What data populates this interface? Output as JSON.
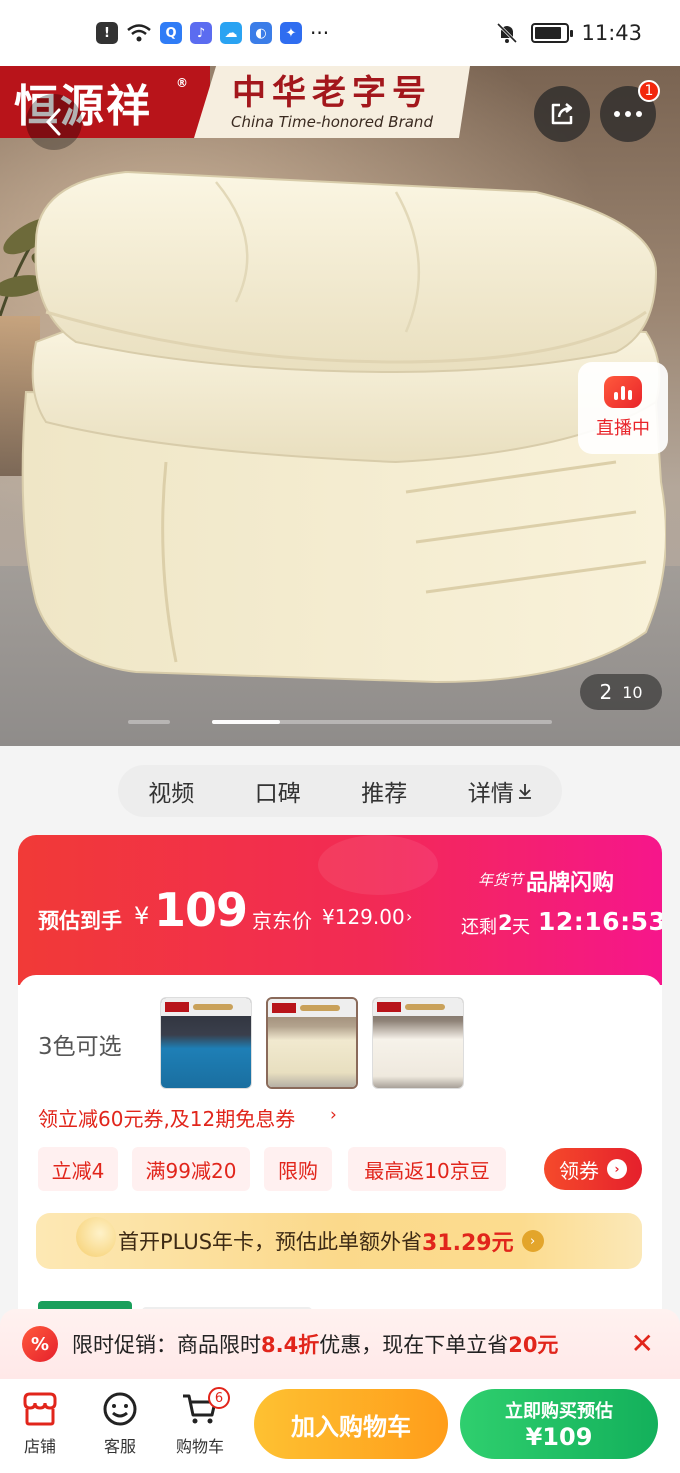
{
  "status_bar": {
    "time": "11:43",
    "more_glyph": "···"
  },
  "hero": {
    "brand_name": "恒源祥",
    "brand_registered": "®",
    "brand_tagline_cn": "中华老字号",
    "brand_tagline_en": "China Time-honored Brand",
    "share_icon": "share-icon",
    "more_badge": "1",
    "live_label": "直播中",
    "image_index": "2",
    "image_total": "10"
  },
  "tabs": [
    {
      "label": "视频"
    },
    {
      "label": "口碑"
    },
    {
      "label": "推荐"
    },
    {
      "label": "详情"
    }
  ],
  "price_card": {
    "est_label": "预估到手",
    "currency": "¥",
    "est_price": "109",
    "jd_label": "京东价",
    "jd_price": "¥129.00",
    "jd_arrow": "›",
    "new_year_label": "年货节",
    "flash_title": "品牌闪购",
    "remain_label": "还剩",
    "remain_days": "2",
    "remain_unit": "天",
    "countdown": "12:16:53",
    "colors_label": "3色可选",
    "swatches": [
      "蓝色",
      "米白",
      "白色"
    ],
    "coupon_line": "领立减60元券,及12期免息券",
    "coupon_arrow": "›",
    "tags": [
      "立减4",
      "满99减20",
      "限购",
      "最高返10京豆"
    ],
    "claim_label": "领券",
    "claim_arrow": "›",
    "plus_text": "首开PLUS年卡，预估此单额外省",
    "plus_amount": "31.29元",
    "plus_arrow": "›"
  },
  "promo": {
    "icon_text": "%",
    "text_prefix": "限时促销：商品限时",
    "discount": "8.4折",
    "text_mid": "优惠，现在下单立省",
    "save_amount": "20元",
    "close": "✕"
  },
  "bottom_bar": {
    "store_label": "店铺",
    "service_label": "客服",
    "cart_label": "购物车",
    "cart_count": "6",
    "add_cart_label": "加入购物车",
    "buy_label": "立即购买预估",
    "buy_price": "¥109"
  },
  "colors": {
    "jd_red": "#e1251b",
    "header_gradient_start": "#f13a37",
    "header_gradient_end": "#f6168b",
    "add_cart": "#ff9d1a",
    "buy_now": "#13b05b"
  },
  "hero_slider_progress": 0.2
}
